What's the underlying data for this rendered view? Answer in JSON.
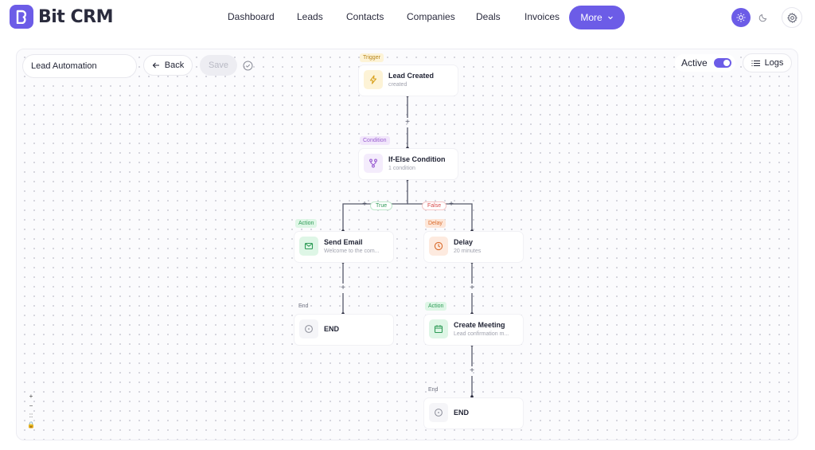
{
  "app": {
    "brand": "Bit CRM"
  },
  "nav": {
    "items": [
      "Dashboard",
      "Leads",
      "Contacts",
      "Companies",
      "Deals",
      "Invoices"
    ],
    "more_label": "More"
  },
  "toolbar": {
    "workflow_name": "Lead Automation",
    "back_label": "Back",
    "save_label": "Save",
    "active_label": "Active",
    "active": true,
    "logs_label": "Logs"
  },
  "workflow": {
    "trigger": {
      "badge": "Trigger",
      "title": "Lead Created",
      "subtitle": "created"
    },
    "condition": {
      "badge": "Condition",
      "title": "If-Else Condition",
      "subtitle": "1 condition"
    },
    "branch_true": "True",
    "branch_false": "False",
    "true_branch": {
      "action": {
        "badge": "Action",
        "title": "Send Email",
        "subtitle": "Welcome to the com..."
      },
      "end": {
        "badge": "End",
        "title": "END"
      }
    },
    "false_branch": {
      "delay": {
        "badge": "Delay",
        "title": "Delay",
        "subtitle": "20 minutes"
      },
      "action": {
        "badge": "Action",
        "title": "Create Meeting",
        "subtitle": "Lead confirmation m..."
      },
      "end": {
        "badge": "End",
        "title": "END"
      }
    }
  },
  "zoom_controls": [
    "+",
    "−",
    "::",
    "🔒"
  ],
  "colors": {
    "accent": "#6c5ce7"
  }
}
